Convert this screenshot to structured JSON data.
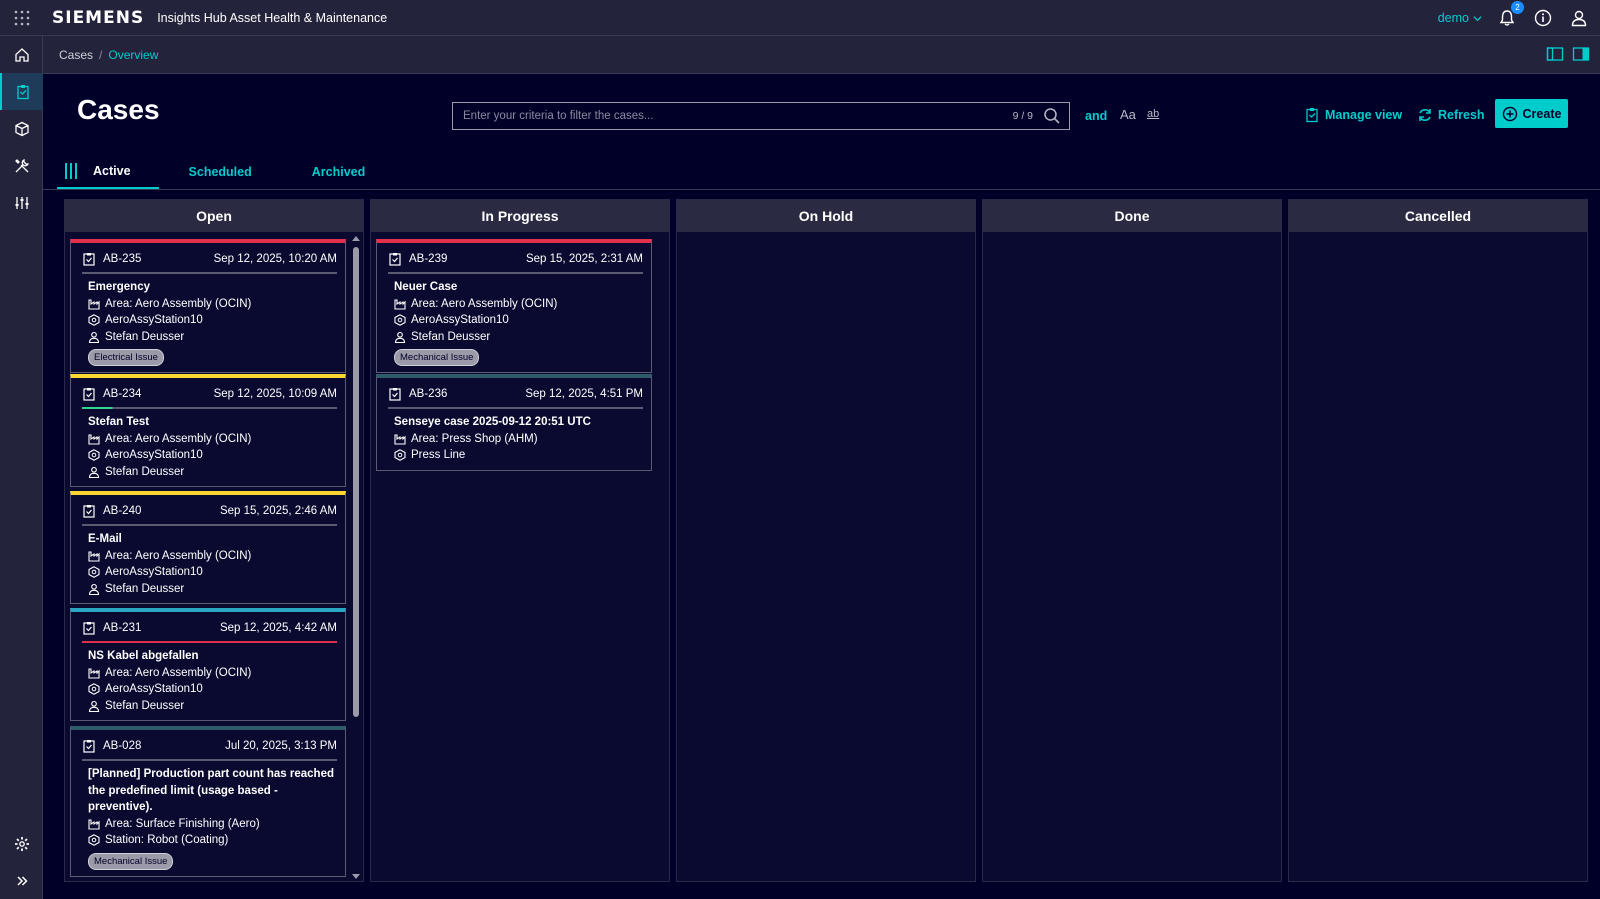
{
  "app": {
    "brand": "SIEMENS",
    "title": "Insights Hub Asset Health & Maintenance",
    "user": "demo",
    "notification_count": "2"
  },
  "breadcrumb": [
    "Cases",
    "Overview"
  ],
  "page": {
    "title": "Cases",
    "filter_placeholder": "Enter your criteria to filter the cases...",
    "filter_count": "9 / 9",
    "filter_and": "and",
    "filter_case": "Aa",
    "filter_word": "ab",
    "manage_view": "Manage view",
    "refresh": "Refresh",
    "create": "Create"
  },
  "tabs": [
    {
      "label": "Active",
      "active": true
    },
    {
      "label": "Scheduled",
      "active": false
    },
    {
      "label": "Archived",
      "active": false
    }
  ],
  "colors": {
    "accent": "#00cccc",
    "red": "#e0304d",
    "yellow": "#ffd732",
    "teal": "#2ba6c4",
    "dark_teal": "#2f5a6a",
    "green": "#2fd68a"
  },
  "columns": [
    {
      "title": "Open",
      "cards": [
        {
          "id": "AB-235",
          "date": "Sep 12, 2025, 10:20 AM",
          "title": "Emergency",
          "area": "Area: Aero Assembly (OCIN)",
          "asset": "AeroAssyStation10",
          "user": "Stefan Deusser",
          "tag": "Electrical Issue",
          "stripe": "red"
        },
        {
          "id": "AB-234",
          "date": "Sep 12, 2025, 10:09 AM",
          "title": "Stefan Test",
          "area": "Area: Aero Assembly (OCIN)",
          "asset": "AeroAssyStation10",
          "user": "Stefan Deusser",
          "tag": "",
          "stripe": "yellow"
        },
        {
          "id": "AB-240",
          "date": "Sep 15, 2025, 2:46 AM",
          "title": "E-Mail",
          "area": "Area: Aero Assembly (OCIN)",
          "asset": "AeroAssyStation10",
          "user": "Stefan Deusser",
          "tag": "",
          "stripe": "yellow"
        },
        {
          "id": "AB-231",
          "date": "Sep 12, 2025, 4:42 AM",
          "title": "NS Kabel abgefallen",
          "area": "Area: Aero Assembly (OCIN)",
          "asset": "AeroAssyStation10",
          "user": "Stefan Deusser",
          "tag": "",
          "stripe": "teal"
        },
        {
          "id": "AB-028",
          "date": "Jul 20, 2025, 3:13 PM",
          "title": "[Planned] Production part count has reached the predefined limit (usage based - preventive).",
          "area": "Area: Surface Finishing (Aero)",
          "asset": "Station: Robot (Coating)",
          "user": "",
          "tag": "Mechanical Issue",
          "stripe": "dark_teal"
        }
      ]
    },
    {
      "title": "In Progress",
      "cards": [
        {
          "id": "AB-239",
          "date": "Sep 15, 2025, 2:31 AM",
          "title": "Neuer Case",
          "area": "Area: Aero Assembly (OCIN)",
          "asset": "AeroAssyStation10",
          "user": "Stefan Deusser",
          "tag": "Mechanical Issue",
          "stripe": "red"
        },
        {
          "id": "AB-236",
          "date": "Sep 12, 2025, 4:51 PM",
          "title": "Senseye case 2025-09-12 20:51 UTC",
          "area": "Area: Press Shop (AHM)",
          "asset": "Press Line",
          "user": "",
          "tag": "",
          "stripe": "dark_teal"
        }
      ]
    },
    {
      "title": "On Hold",
      "cards": []
    },
    {
      "title": "Done",
      "cards": []
    },
    {
      "title": "Cancelled",
      "cards": []
    }
  ]
}
